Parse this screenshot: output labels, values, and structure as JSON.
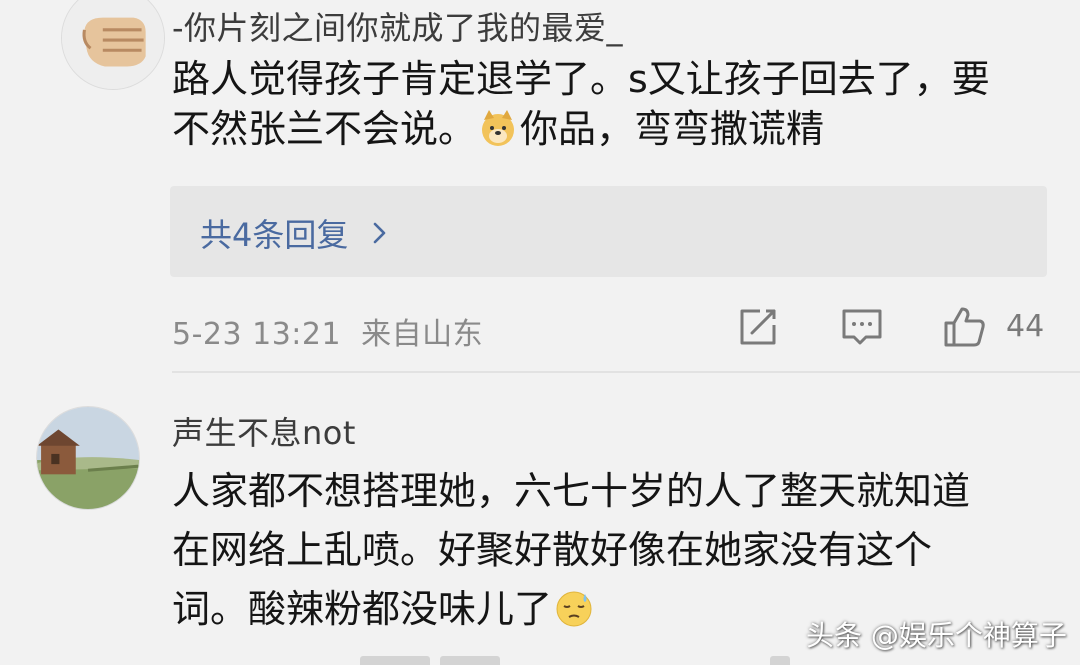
{
  "comments": [
    {
      "username": "-你片刻之间你就成了我的最爱_",
      "lines": [
        "路人觉得孩子肯定退学了。s又让孩子回去了，要",
        "不然张兰不会说。",
        "你品，弯弯撒谎精"
      ],
      "emoji": "doge-emoji",
      "replies_label": "共4条回复",
      "time": "5-23 13:21",
      "location": "来自山东",
      "likes": "44"
    },
    {
      "username": "声生不息not",
      "lines": [
        "人家都不想搭理她，六七十岁的人了整天就知道",
        "在网络上乱喷。好聚好散好像在她家没有这个",
        "词。酸辣粉都没味儿了"
      ],
      "emoji": "sweat-emoji"
    }
  ],
  "watermark": "头条 @娱乐个神算子",
  "icons": {
    "share": "share-icon",
    "comment": "comment-icon",
    "like": "thumbs-up-icon",
    "reply_chevron": "chevron-right-icon"
  },
  "colors": {
    "background": "#f2f2f2",
    "reply_link": "#4a6aa0",
    "meta_text": "#8a8a8a"
  }
}
